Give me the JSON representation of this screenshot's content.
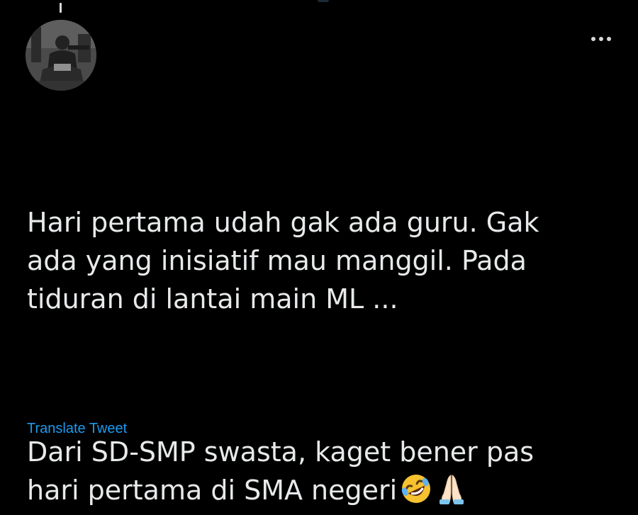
{
  "tweet": {
    "lines_p1": "Hari pertama udah gak ada guru. Gak\nada yang inisiatif mau manggil. Pada\ntiduran di lantai main ML ...",
    "lines_p2": "Dari SD-SMP swasta, kaget bener pas\nhari pertama di SMA negeri",
    "emojis": [
      "rolling-on-floor-laughing-emoji",
      "folded-hands-emoji"
    ],
    "translate_label": "Translate Tweet"
  },
  "icons": {
    "more": "more-options-icon",
    "avatar": "profile-avatar"
  },
  "colors": {
    "background": "#000000",
    "text": "#e7e9ea",
    "link": "#1d9bf0",
    "icon": "#d9d9d9"
  }
}
